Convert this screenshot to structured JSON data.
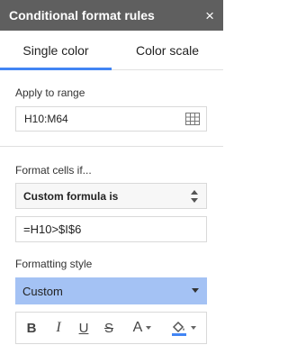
{
  "header": {
    "title": "Conditional format rules",
    "close_icon": "×"
  },
  "tabs": [
    {
      "label": "Single color",
      "active": true
    },
    {
      "label": "Color scale",
      "active": false
    }
  ],
  "apply_to_range": {
    "label": "Apply to range",
    "value": "H10:M64"
  },
  "format_cells_if": {
    "label": "Format cells if...",
    "selected": "Custom formula is",
    "formula_value": "=H10>$I$6"
  },
  "formatting_style": {
    "label": "Formatting style",
    "selected": "Custom",
    "highlight_color": "#a4c2f4"
  },
  "toolbar": {
    "bold": "B",
    "italic": "I",
    "underline": "U",
    "strikethrough": "S",
    "text_color": "A"
  },
  "colors": {
    "header_bg": "#5f5f5f",
    "accent": "#4285f4",
    "fill_swatch": "#4285f4"
  }
}
